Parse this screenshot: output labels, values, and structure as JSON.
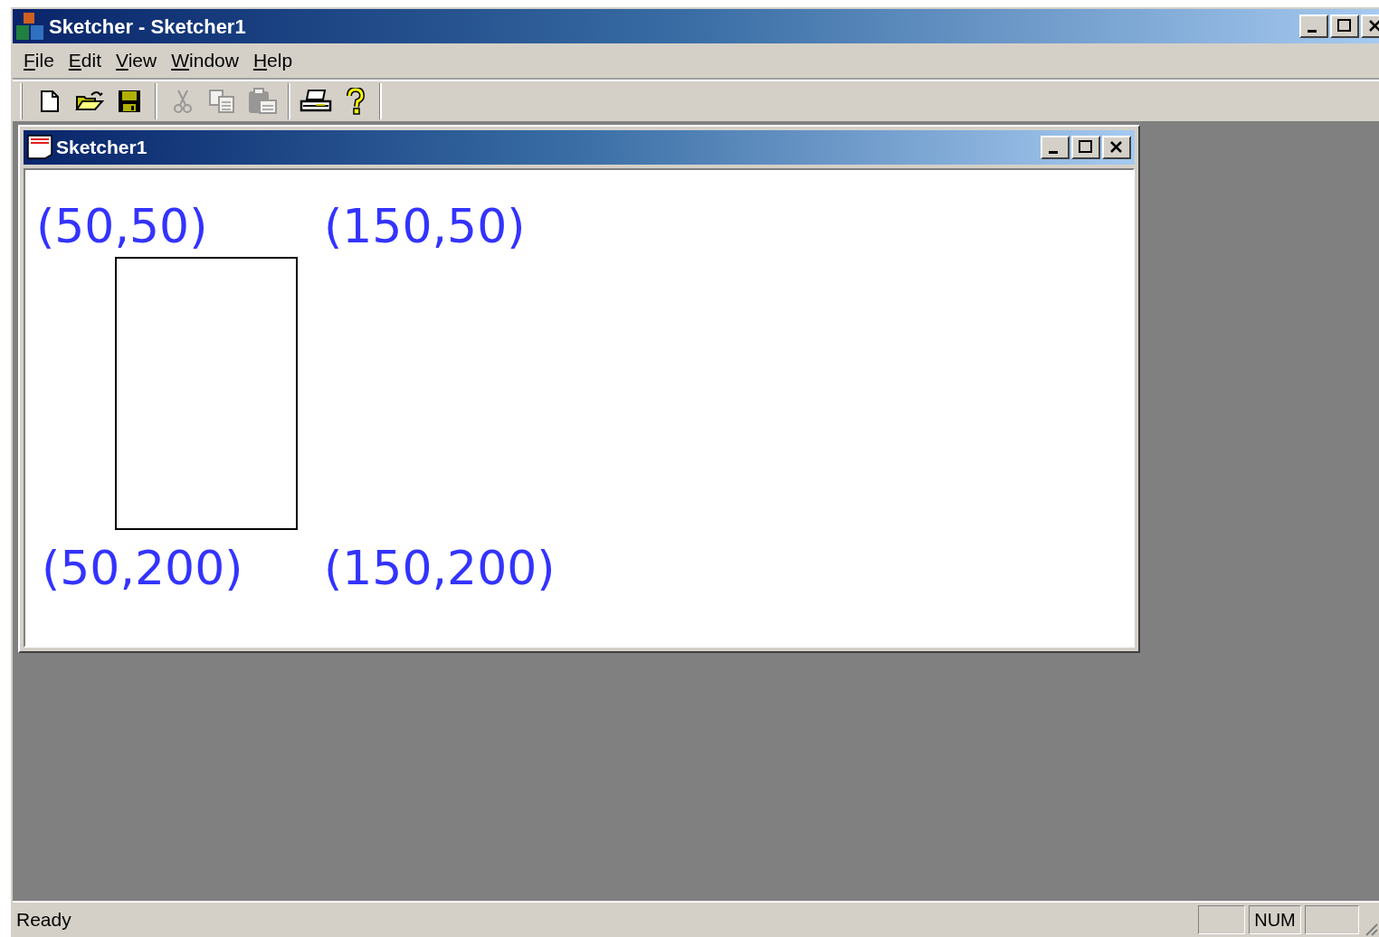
{
  "window": {
    "title": "Sketcher - Sketcher1"
  },
  "menu": [
    {
      "label": "File"
    },
    {
      "label": "Edit"
    },
    {
      "label": "View"
    },
    {
      "label": "Window"
    },
    {
      "label": "Help"
    }
  ],
  "toolbar": [
    {
      "kind": "new",
      "disabled": false
    },
    {
      "kind": "open",
      "disabled": false
    },
    {
      "kind": "save",
      "disabled": false
    },
    {
      "kind": "separator"
    },
    {
      "kind": "cut",
      "disabled": true
    },
    {
      "kind": "copy",
      "disabled": true
    },
    {
      "kind": "paste",
      "disabled": true
    },
    {
      "kind": "separator"
    },
    {
      "kind": "print",
      "disabled": false
    },
    {
      "kind": "help",
      "disabled": false
    }
  ],
  "document": {
    "title": "Sketcher1",
    "labels": [
      "(50,50)",
      "(150,50)",
      "(50,200)",
      "(150,200)"
    ]
  },
  "status_bar": {
    "message": "Ready",
    "indicator": "NUM"
  }
}
